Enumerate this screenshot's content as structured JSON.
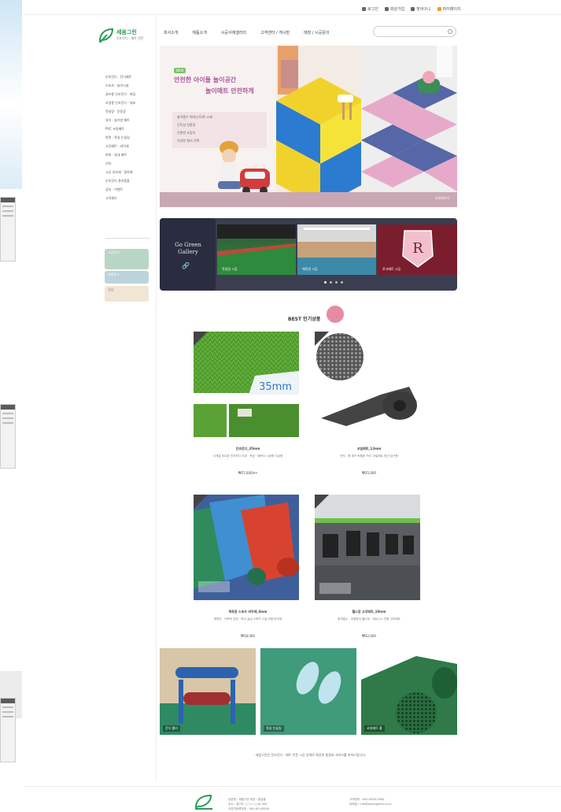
{
  "utility_links": [
    "로그인",
    "회원가입",
    "장바구니",
    "마이페이지"
  ],
  "logo": {
    "title": "세움그린",
    "subtitle": "인조잔디 · 매트 전문"
  },
  "nav": [
    "회사소개",
    "제품소개",
    "시공사례갤러리",
    "고객센터 / 게시판",
    "매장 / 시공문의"
  ],
  "search": {
    "placeholder": ""
  },
  "menu": [
    "인조잔디 · 잔디매트",
    "스포츠 · 놀이시설",
    "골프용 인조잔디 · 퍼팅",
    "조경용 인조잔디 · 데코",
    "풋살장 · 운동장",
    "유아 · 놀이방 매트",
    "PVC 코일매트",
    "현관 · 욕실 논슬립",
    "고무매트 · 바닥재",
    "야외 · 실내 매트",
    "기타",
    "시공 부자재 · 접착제",
    "인조잔디 관리용품",
    "공지 · 이벤트",
    "고객센터"
  ],
  "mini_banners": [
    "시공문의",
    "카탈로그",
    "상담"
  ],
  "hero": {
    "kicker": "NEW",
    "line1": "안전한 아이들 놀이공간",
    "line2": "놀이매트 안전하게",
    "bullets": [
      "충격흡수 뛰어난 EVA 소재",
      "무독성 친환경",
      "간편한 조립식",
      "다양한 컬러 선택"
    ],
    "footer": "자세히보기"
  },
  "gallery": {
    "title": "Go Green Gallery",
    "slides": [
      "풋살장 시공",
      "체육관 시공",
      "로고매트 시공"
    ]
  },
  "best": {
    "title": "BEST 인기상품"
  },
  "products": [
    {
      "name": "인조잔디_35mm",
      "desc": "사계절 푸르른 인조잔디 조경 · 옥상 · 베란다 시공용 고급형",
      "price": "₩15,000/m²",
      "img_label": "35mm"
    },
    {
      "name": "코일매트_12mm",
      "desc": "먼지 · 흙 제거 탁월한 PVC 코일매트 현관 입구용",
      "price": "₩25,000"
    },
    {
      "name": "체육관 스포츠 바닥재_4mm",
      "desc": "체육관 · 다목적 강당 · 학교 실내 스포츠 시설 전용 바닥재",
      "price": "₩18,000"
    },
    {
      "name": "헬스장 고무매트_10mm",
      "desc": "충격흡수 · 소음방지 헬스장 · 피트니스 전용 고무매트",
      "price": "₩32,000"
    }
  ],
  "bottom_row": [
    "잔디 롤러",
    "욕실 논슬립",
    "코일매트 롤"
  ],
  "bottom_text": "세움그린은 인조잔디 · 매트 전문 시공 업체로 최상의 품질과 서비스를 약속드립니다.",
  "footer": {
    "info1": [
      "상호명 : 세움그린   대표 : 홍길동",
      "주소 : 경기도 ○○시 ○○로 000",
      "사업자등록번호 : 000-00-00000"
    ],
    "info2": [
      "고객센터 : 000-0000-0000",
      "이메일 : info@seumgreen.co.kr"
    ]
  }
}
